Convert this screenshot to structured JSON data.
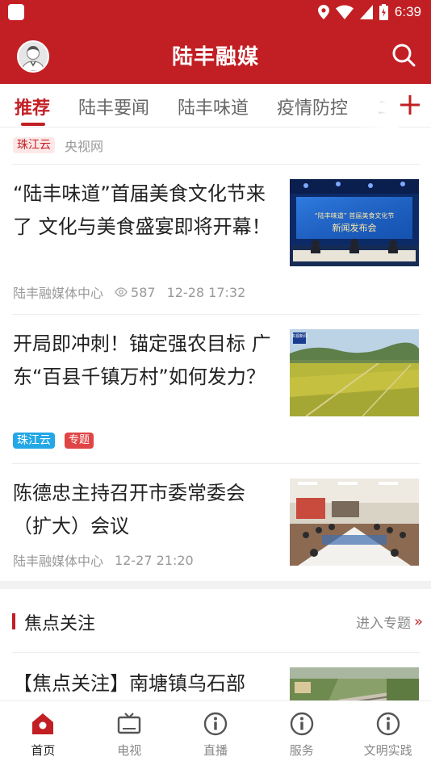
{
  "status_bar": {
    "time": "6:39"
  },
  "header": {
    "title": "陆丰融媒"
  },
  "tabs": [
    {
      "label": "推荐",
      "active": true
    },
    {
      "label": "陆丰要闻"
    },
    {
      "label": "陆丰味道"
    },
    {
      "label": "疫情防控"
    },
    {
      "label": "二"
    }
  ],
  "feed": {
    "partial": {
      "tag": "珠江云",
      "source": "央视网"
    },
    "articles": [
      {
        "title": "“陆丰味道”首届美食文化节来了 文化与美食盛宴即将开幕！",
        "source": "陆丰融媒体中心",
        "views": "587",
        "time": "12-28 17:32",
        "image_caption_line1": "“陆丰味道” 首届美食文化节",
        "image_caption_line2": "新闻发布会"
      },
      {
        "title": "开局即冲刺！锚定强农目标 广东“百县千镇万村”如何发力？",
        "tags": [
          "珠江云",
          "专题"
        ],
        "image_logo": "央视新闻"
      },
      {
        "title": "陈德忠主持召开市委常委会（扩大）会议",
        "source": "陆丰融媒体中心",
        "time": "12-27 21:20"
      }
    ],
    "focus": {
      "section_title": "焦点关注",
      "more_label": "进入专题",
      "more_icon": "»",
      "article_title": "【焦点关注】南塘镇乌石部"
    }
  },
  "bottom_nav": [
    {
      "label": "首页",
      "icon": "home-icon",
      "active": true
    },
    {
      "label": "电视",
      "icon": "tv-icon"
    },
    {
      "label": "直播",
      "icon": "info-icon"
    },
    {
      "label": "服务",
      "icon": "info-icon"
    },
    {
      "label": "文明实践",
      "icon": "info-icon"
    }
  ],
  "colors": {
    "brand": "#c21f24",
    "tag_blue": "#23a7e6",
    "muted": "#999999"
  }
}
